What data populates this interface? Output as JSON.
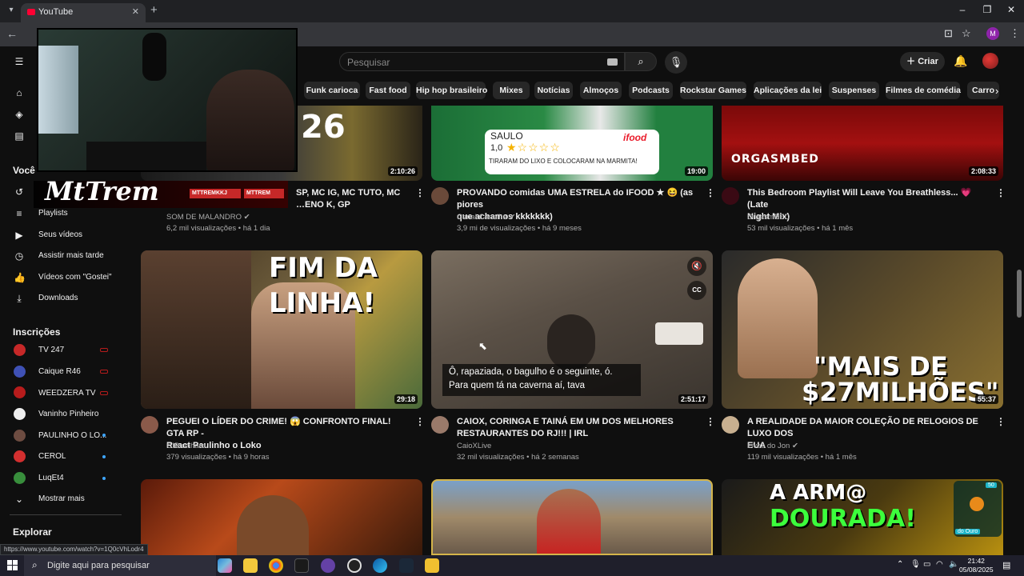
{
  "browser": {
    "tab_title": "YouTube",
    "new_tab": "+",
    "window_controls": [
      "–",
      "❐",
      "✕"
    ],
    "profile_initial": "M"
  },
  "header": {
    "search_placeholder": "Pesquisar",
    "create_label": "Criar"
  },
  "chips": [
    "Funk carioca",
    "Fast food",
    "Hip hop brasileiro",
    "Mixes",
    "Notícias",
    "Almoços",
    "Podcasts",
    "Rockstar Games",
    "Aplicações da lei",
    "Suspenses",
    "Filmes de comédia",
    "Carro"
  ],
  "sidebar": {
    "you_heading": "Você",
    "you_items": [
      "Playlists",
      "Seus vídeos",
      "Assistir mais tarde",
      "Vídeos com \"Gostei\"",
      "Downloads"
    ],
    "subs_heading": "Inscrições",
    "subs": [
      {
        "name": "TV 247",
        "status": "live",
        "color": "#c62828"
      },
      {
        "name": "Caique R46",
        "status": "live",
        "color": "#3f51b5"
      },
      {
        "name": "WEEDZERA TV",
        "status": "live",
        "color": "#b71c1c"
      },
      {
        "name": "Vaninho Pinheiro",
        "status": "none",
        "color": "#eeeeee"
      },
      {
        "name": "PAULINHO O LO...",
        "status": "dot",
        "color": "#6d4c41"
      },
      {
        "name": "CEROL",
        "status": "dot",
        "color": "#d32f2f"
      },
      {
        "name": "LuqEt4",
        "status": "dot",
        "color": "#388e3c"
      }
    ],
    "show_more": "Mostrar mais",
    "explore_heading": "Explorar"
  },
  "videos": [
    {
      "title_line1": "SP, MC IG, MC TUTO, MC",
      "title_line2": "…ENO K, GP",
      "channel": "SOM DE MALANDRO",
      "meta": "6,2 mil visualizações • há 1 dia",
      "duration": "2:10:26"
    },
    {
      "title_line1": "PROVANDO comidas UMA ESTRELA do IFOOD ★ 😆 (as piores",
      "title_line2": "que achamos kkkkkkk)",
      "channel": "Canal Canalha",
      "meta": "3,9 mi de visualizações • há 9 meses",
      "duration": "19:00",
      "thumb_lines": [
        "SAULO",
        "1,0",
        "ifood",
        "TIRARAM DO LIXO E COLOCARAM NA MARMITA!"
      ]
    },
    {
      "title_line1": "This Bedroom Playlist Will Leave You Breathless... 💗 (Late",
      "title_line2": "Night Mix)",
      "channel": "OrgasmBED",
      "meta": "53 mil visualizações • há 1 mês",
      "duration": "2:08:33",
      "thumb_text": "ORGASMBED"
    },
    {
      "title_line1": "PEGUEI O LÍDER DO CRIME! 😱 CONFRONTO FINAL! GTA RP -",
      "title_line2": "React Paulinho o Loko",
      "channel": "GIBrunhara",
      "meta": "379 visualizações • há 9 horas",
      "duration": "29:18",
      "thumb_text": "FIM DA LINHA!"
    },
    {
      "title_line1": "CAIOX, CORINGA E TAINÁ EM UM DOS MELHORES",
      "title_line2": "RESTAURANTES DO RJ!!! | IRL",
      "channel": "CaioXLive",
      "meta": "32 mil visualizações • há 2 semanas",
      "duration": "2:51:17",
      "caption_line1": "Ô, rapaziada, o bagulho é o seguinte, ó.",
      "caption_line2": "Para quem tá na caverna aí, tava"
    },
    {
      "title_line1": "A REALIDADE DA MAIOR COLEÇÃO DE RELOGIOS DE LUXO DOS",
      "title_line2": "EUA",
      "channel": "Lives do Jon",
      "meta": "119 mil visualizações • há 1 mês",
      "duration": "55:37",
      "thumb_lines": [
        "\"MAIS DE",
        "$27MILHÕES\""
      ]
    }
  ],
  "bottom_row": {
    "text1": "A ARM@",
    "text2": "DOURADA!",
    "badge": "50",
    "chip": "do Ouro"
  },
  "overlay": {
    "brand": "MtTrem",
    "social1": "MTTREMKKJ",
    "social2": "MTTREM"
  },
  "status_url": "https://www.youtube.com/watch?v=1Q0cVhLodr4",
  "taskbar": {
    "search_placeholder": "Digite aqui para pesquisar",
    "time": "21:42",
    "date": "05/08/2025"
  }
}
